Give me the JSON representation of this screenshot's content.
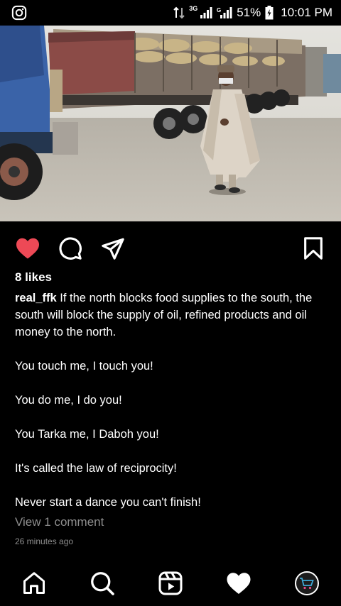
{
  "status_bar": {
    "network": "3G",
    "battery": "51%",
    "time": "10:01 PM",
    "icons": [
      "instagram-icon",
      "data-arrows-icon",
      "signal-icon",
      "battery-charging-icon"
    ]
  },
  "post": {
    "image_alt_icon": "truck-photo",
    "likes": "8 likes",
    "author": "real_ffk",
    "caption_first": "If the north blocks food supplies to the south, the south will block the supply of oil, refined products and oil money to the north.",
    "caption_lines": [
      "You touch me, I touch you!",
      "You do me, I do you!",
      "You Tarka me, I Daboh you!",
      "It's called the law of reciprocity!",
      "Never start a dance you can't finish!"
    ],
    "view_comments": "View 1 comment",
    "time_ago": "26 minutes ago"
  },
  "actions": {
    "like_icon": "heart-filled-icon",
    "comment_icon": "comment-icon",
    "share_icon": "send-icon",
    "save_icon": "bookmark-icon",
    "like_color": "#ed4956"
  },
  "bottom_nav": {
    "items": [
      "home-icon",
      "search-icon",
      "reels-icon",
      "activity-heart-icon",
      "profile-avatar"
    ]
  }
}
